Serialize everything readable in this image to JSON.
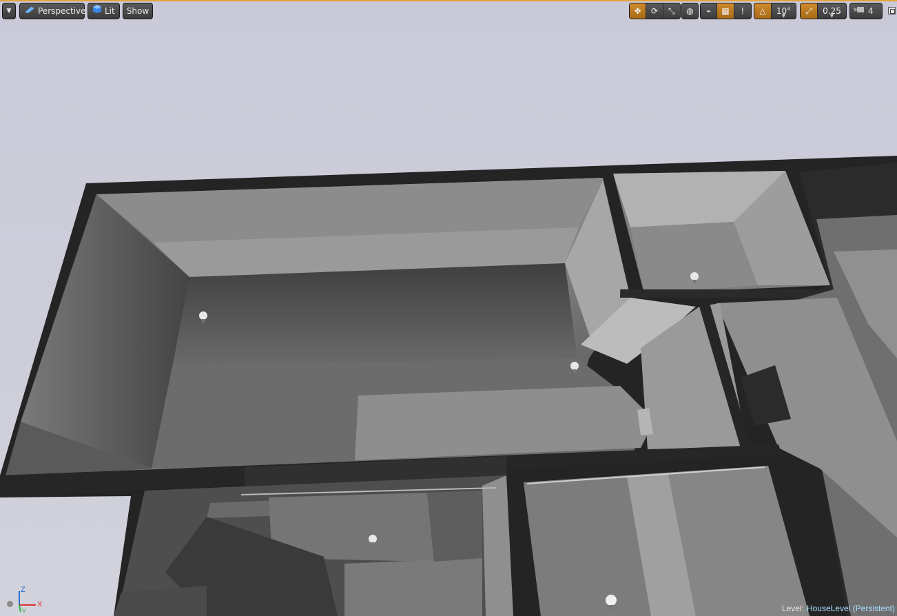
{
  "toolbar": {
    "view_mode_label": "Perspective",
    "lighting_label": "Lit",
    "show_label": "Show",
    "rotation_snap_value": "10°",
    "scale_snap_value": "0.25",
    "camera_speed_value": "4"
  },
  "status": {
    "level_key": "Level:",
    "level_value": "HouseLevel (Persistent)"
  },
  "axis": {
    "z": "Z",
    "x": "X",
    "y": "Y"
  },
  "icons": {
    "dropdown": "chevron-down-icon",
    "perspective": "perspective-camera-icon",
    "lit": "lit-cube-icon",
    "translate": "move-icon",
    "rotate": "rotate-icon",
    "scale": "scale-icon",
    "world": "world-space-icon",
    "surface_snap": "surface-snapping-icon",
    "grid_snap": "grid-snap-icon",
    "angle_snap": "angle-snap-icon",
    "scale_snap": "scale-snap-icon",
    "camera_speed": "camera-speed-icon",
    "maximize": "maximize-viewport-icon"
  },
  "colors": {
    "accent": "#e8a33d",
    "sky": "#c9c9d6",
    "level_value": "#a8e0ff"
  }
}
